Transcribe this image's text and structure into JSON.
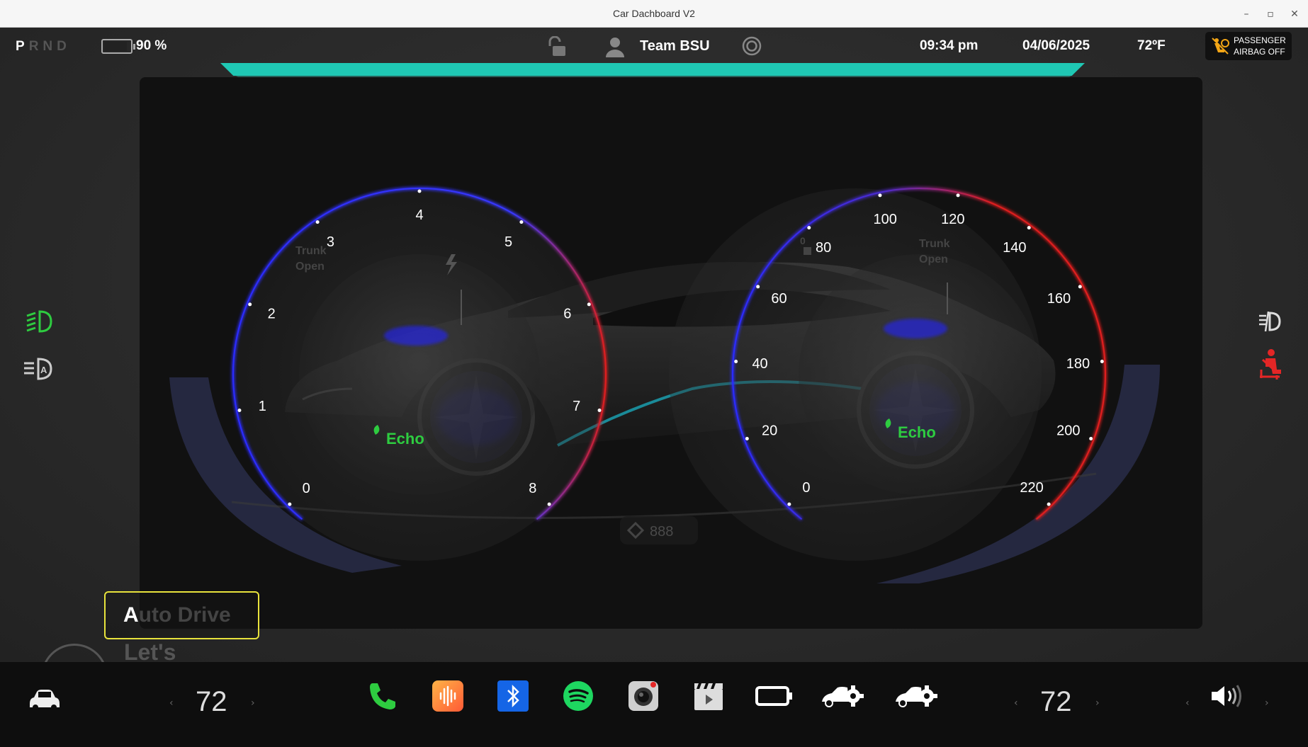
{
  "window": {
    "title": "Car Dachboard V2",
    "controls": {
      "minimize": "–",
      "maximize": "▫",
      "close": "✕"
    }
  },
  "status": {
    "gears": [
      "P",
      "R",
      "N",
      "D"
    ],
    "active_gear": "P",
    "battery_text": "90 %",
    "battery_level": 0.9,
    "user_name": "Team BSU",
    "time": "09:34 pm",
    "date": "04/06/2025",
    "temperature": "72ºF",
    "airbag": {
      "line1": "PASSENGER",
      "line2": "AIRBAG OFF"
    }
  },
  "left_gauge": {
    "ticks": [
      "0",
      "1",
      "2",
      "3",
      "4",
      "5",
      "6",
      "7",
      "8"
    ],
    "mode_label": "Echo",
    "faded_text": {
      "line1": "Trunk",
      "line2": "Open"
    }
  },
  "right_gauge": {
    "ticks": [
      "0",
      "20",
      "40",
      "60",
      "80",
      "100",
      "120",
      "140",
      "160",
      "180",
      "200",
      "220"
    ],
    "mode_label": "Echo",
    "faded_text": {
      "line1": "Trunk",
      "line2": "Open"
    },
    "faded_digit": "0"
  },
  "odometer": {
    "value": "888"
  },
  "auto_drive": {
    "first_letter": "A",
    "rest": "uto Drive"
  },
  "lets_text": "Let's",
  "dock": {
    "left_temp": "72",
    "right_temp": "72",
    "arrow_left": "‹",
    "arrow_right": "›",
    "icons": [
      "car-icon",
      "phone-icon",
      "audio-icon",
      "bluetooth-icon",
      "spotify-icon",
      "camera-icon",
      "video-icon",
      "battery-icon",
      "car-settings-icon",
      "car-settings-icon",
      "volume-icon"
    ]
  },
  "colors": {
    "teal": "#1fc8b4",
    "blue_arc": "#2a2aff",
    "red_arc": "#e01e1e",
    "echo_green": "#2ecc40",
    "icon_green": "#2ecc40",
    "icon_red": "#e32626",
    "auto_drive_border": "#e8e33c"
  }
}
